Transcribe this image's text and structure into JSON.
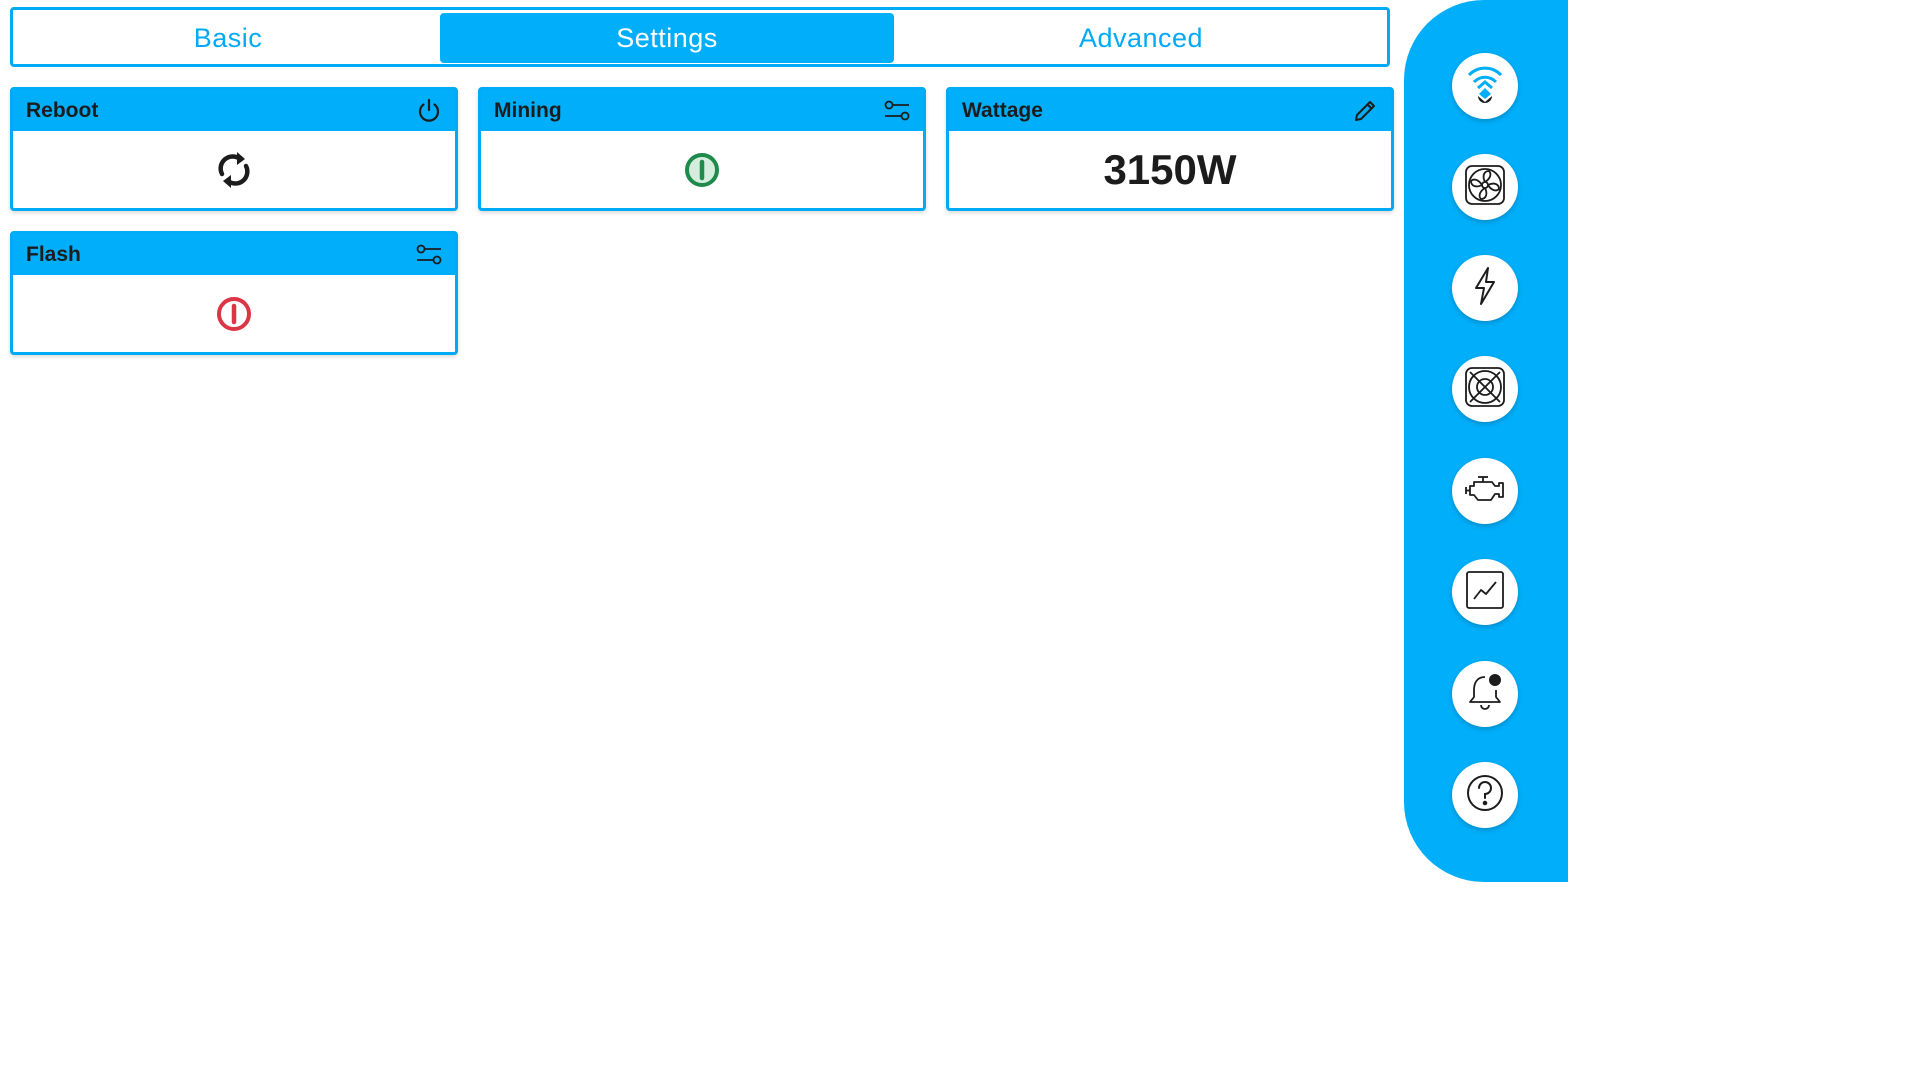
{
  "tabs": [
    {
      "label": "Basic",
      "active": false
    },
    {
      "label": "Settings",
      "active": true
    },
    {
      "label": "Advanced",
      "active": false
    }
  ],
  "cards": {
    "reboot": {
      "title": "Reboot",
      "header_icon": "power-icon",
      "body_icon": "refresh-icon"
    },
    "mining": {
      "title": "Mining",
      "header_icon": "sliders-icon",
      "body_icon": "power-on-icon",
      "status_color": "#1e8a4c"
    },
    "wattage": {
      "title": "Wattage",
      "header_icon": "pencil-icon",
      "value": "3150W"
    },
    "flash": {
      "title": "Flash",
      "header_icon": "sliders-icon",
      "body_icon": "power-off-icon",
      "status_color": "#dc3545"
    }
  },
  "sidebar": {
    "items": [
      {
        "icon": "wifi-icon"
      },
      {
        "icon": "fan-icon"
      },
      {
        "icon": "lightning-icon"
      },
      {
        "icon": "fan-grid-icon"
      },
      {
        "icon": "engine-icon"
      },
      {
        "icon": "chart-icon"
      },
      {
        "icon": "bell-notification-icon"
      },
      {
        "icon": "help-icon"
      }
    ]
  },
  "colors": {
    "accent": "#00aef9",
    "text": "#1c1c1c",
    "on": "#1e8a4c",
    "off": "#dc3545"
  }
}
